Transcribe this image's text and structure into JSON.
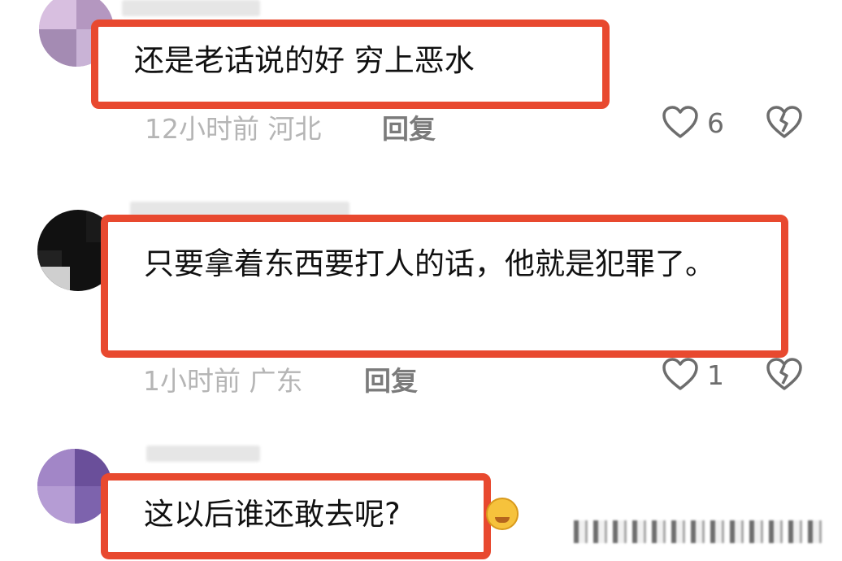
{
  "comments": [
    {
      "text": "还是老话说的好 穷上恶水",
      "time": "12小时前",
      "location": "河北",
      "reply_label": "回复",
      "likes": "6"
    },
    {
      "text": "只要拿着东西要打人的话，他就是犯罪了。",
      "time": "1小时前",
      "location": "广东",
      "reply_label": "回复",
      "likes": "1"
    },
    {
      "text": "这以后谁还敢去呢?"
    }
  ],
  "icons": {
    "like": "heart-outline-icon",
    "dislike": "broken-heart-icon",
    "emoji": "sad-face-emoji"
  },
  "colors": {
    "highlight_border": "#e8492f",
    "meta_text": "#b5b5b5",
    "reply_text": "#7b7b7b"
  }
}
